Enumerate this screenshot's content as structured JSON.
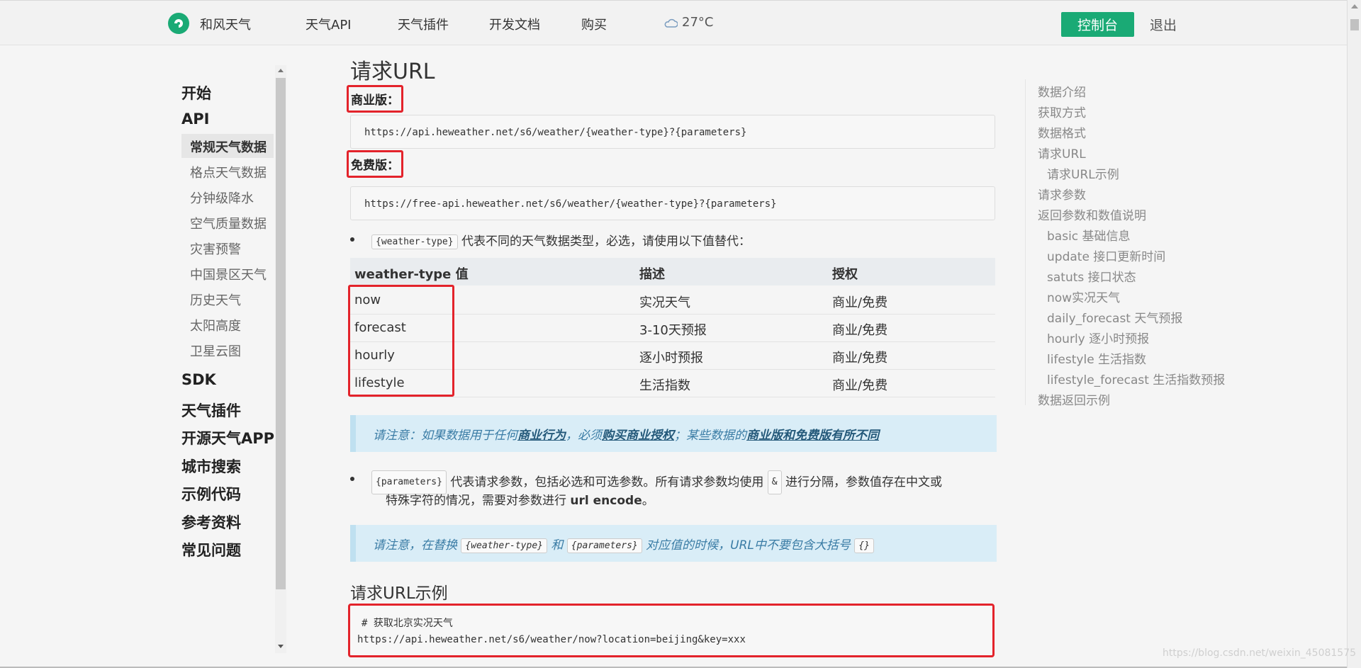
{
  "nav": {
    "brand": "和风天气",
    "items": [
      "天气API",
      "天气插件",
      "开发文档",
      "购买"
    ],
    "weather": "27°C",
    "console_label": "控制台",
    "logout_label": "退出",
    "accent": "#1aaa75"
  },
  "sidebar": {
    "groups": [
      "开始",
      "API",
      "SDK",
      "天气插件",
      "开源天气APP",
      "城市搜索",
      "示例代码",
      "参考资料",
      "常见问题"
    ],
    "api_items": [
      "常规天气数据",
      "格点天气数据",
      "分钟级降水",
      "空气质量数据",
      "灾害预警",
      "中国景区天气",
      "历史天气",
      "太阳高度",
      "卫星云图"
    ],
    "active": "常规天气数据"
  },
  "main": {
    "title": "请求URL",
    "commercial_label": "商业版：",
    "commercial_url": "https://api.heweather.net/s6/weather/{weather-type}?{parameters}",
    "free_label": "免费版：",
    "free_url": "https://free-api.heweather.net/s6/weather/{weather-type}?{parameters}",
    "weather_type_code": "{weather-type}",
    "weather_type_desc": "代表不同的天气数据类型，必选，请使用以下值替代：",
    "table": {
      "headers": [
        "weather-type 值",
        "描述",
        "授权"
      ],
      "rows": [
        [
          "now",
          "实况天气",
          "商业/免费"
        ],
        [
          "forecast",
          "3-10天预报",
          "商业/免费"
        ],
        [
          "hourly",
          "逐小时预报",
          "商业/免费"
        ],
        [
          "lifestyle",
          "生活指数",
          "商业/免费"
        ]
      ]
    },
    "notice1": {
      "part1": "请注意：如果数据用于任何",
      "link1": "商业行为",
      "part2": "，必须",
      "link2": "购买商业授权",
      "part3": "；某些数据的",
      "link3": "商业版和免费版有所不同"
    },
    "params_code": "{parameters}",
    "params_desc1": "代表请求参数，包括必选和可选参数。所有请求参数均使用",
    "amp_code": "&",
    "params_desc2": "进行分隔，参数值存在中文或",
    "params_desc3": "特殊字符的情况，需要对参数进行",
    "params_bold": "url encode",
    "params_end": "。",
    "notice2": {
      "part1": "请注意，在替换",
      "code1": "{weather-type}",
      "part2": "和",
      "code2": "{parameters}",
      "part3": "对应值的时候，URL中不要包含大括号",
      "code3": "{}"
    },
    "example_title": "请求URL示例",
    "example_comment": "# 获取北京实况天气",
    "example_url": "https://api.heweather.net/s6/weather/now?location=beijing&key=xxx"
  },
  "toc": [
    {
      "label": "数据介绍",
      "sub": false
    },
    {
      "label": "获取方式",
      "sub": false
    },
    {
      "label": "数据格式",
      "sub": false
    },
    {
      "label": "请求URL",
      "sub": false
    },
    {
      "label": "请求URL示例",
      "sub": true
    },
    {
      "label": "请求参数",
      "sub": false
    },
    {
      "label": "返回参数和数值说明",
      "sub": false
    },
    {
      "label": "basic 基础信息",
      "sub": true
    },
    {
      "label": "update 接口更新时间",
      "sub": true
    },
    {
      "label": "satuts 接口状态",
      "sub": true
    },
    {
      "label": "now实况天气",
      "sub": true
    },
    {
      "label": "daily_forecast 天气预报",
      "sub": true
    },
    {
      "label": "hourly 逐小时预报",
      "sub": true
    },
    {
      "label": "lifestyle 生活指数",
      "sub": true
    },
    {
      "label": "lifestyle_forecast 生活指数预报",
      "sub": true
    },
    {
      "label": "数据返回示例",
      "sub": false
    }
  ],
  "watermark": "https://blog.csdn.net/weixin_45081575"
}
